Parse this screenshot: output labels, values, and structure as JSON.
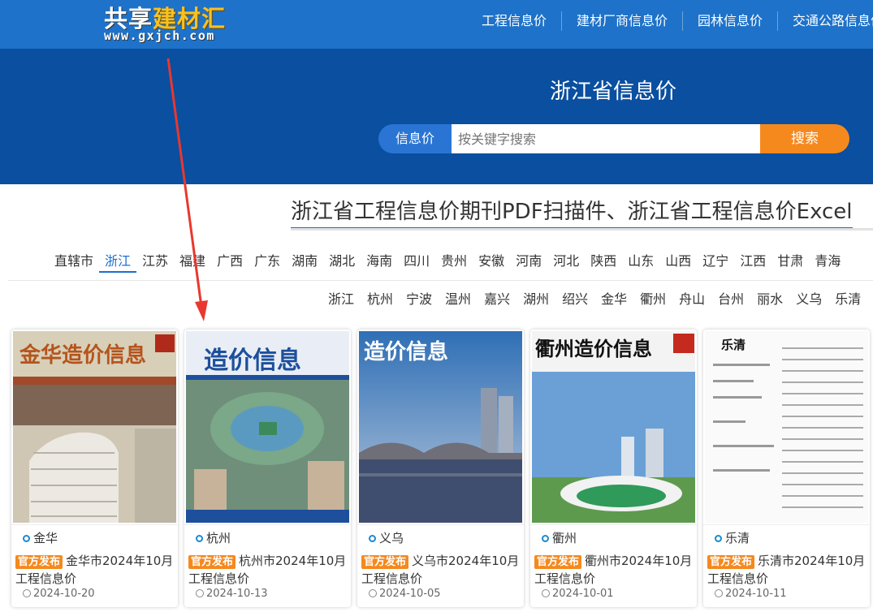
{
  "logo": {
    "part1": "共享",
    "part2": "建材汇",
    "url": "www.gxjch.com"
  },
  "topnav": [
    "工程信息价",
    "建材厂商信息价",
    "园林信息价",
    "交通公路信息价"
  ],
  "hero": {
    "title": "浙江省信息价",
    "search_category": "信息价",
    "search_placeholder": "按关键字搜索",
    "search_button": "搜索"
  },
  "headline": "浙江省工程信息价期刊PDF扫描件、浙江省工程信息价Excel",
  "provinces": [
    "直辖市",
    "浙江",
    "江苏",
    "福建",
    "广西",
    "广东",
    "湖南",
    "湖北",
    "海南",
    "四川",
    "贵州",
    "安徽",
    "河南",
    "河北",
    "陕西",
    "山东",
    "山西",
    "辽宁",
    "江西",
    "甘肃",
    "青海"
  ],
  "active_province": "浙江",
  "cities": [
    "浙江",
    "杭州",
    "宁波",
    "温州",
    "嘉兴",
    "湖州",
    "绍兴",
    "金华",
    "衢州",
    "舟山",
    "台州",
    "丽水",
    "义乌",
    "乐清"
  ],
  "badge": "官方发布",
  "cards": [
    {
      "city": "金华",
      "title": "金华市2024年10月工程信息价",
      "date": "2024-10-20",
      "cover_title": "金华造价信息"
    },
    {
      "city": "杭州",
      "title": "杭州市2024年10月工程信息价",
      "date": "2024-10-13",
      "cover_title": "造价信息"
    },
    {
      "city": "义乌",
      "title": "义乌市2024年10月工程信息价",
      "date": "2024-10-05",
      "cover_title": "造价信息"
    },
    {
      "city": "衢州",
      "title": "衢州市2024年10月工程信息价",
      "date": "2024-10-01",
      "cover_title": "衢州造价信息"
    },
    {
      "city": "乐清",
      "title": "乐清市2024年10月工程信息价",
      "date": "2024-10-11",
      "cover_title": "乐清"
    }
  ],
  "colors": {
    "topbar": "#1e72c9",
    "hero": "#0a4fa0",
    "accent": "#f5891e",
    "active": "#1a6fd0",
    "arrow": "#e8382f"
  }
}
